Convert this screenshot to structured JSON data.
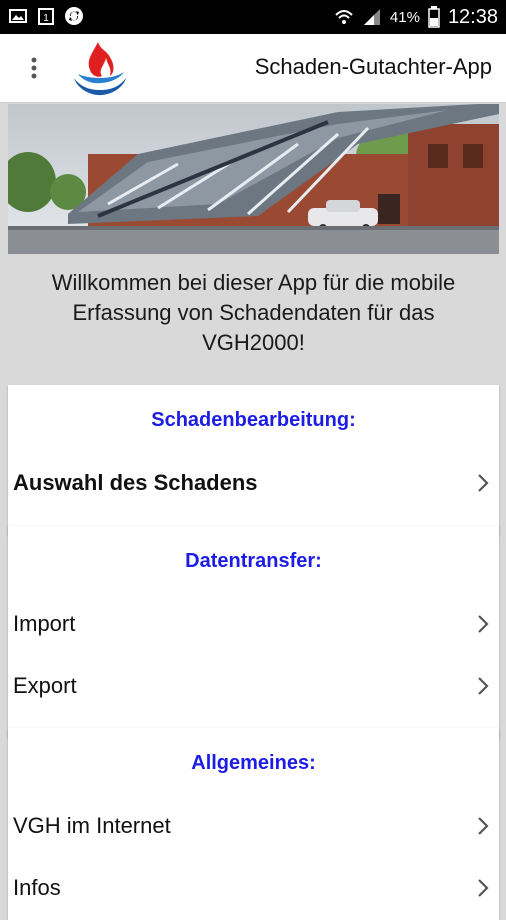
{
  "status_bar": {
    "battery_percent": "41%",
    "time": "12:38",
    "left_icons": [
      "photo-icon",
      "calendar-icon",
      "sync-icon"
    ],
    "right_icons": [
      "wifi-icon",
      "signal-icon",
      "battery-icon"
    ]
  },
  "app_bar": {
    "title": "Schaden-Gutachter-App",
    "menu_icon": "overflow-menu-icon",
    "logo_icon": "flame-logo-icon"
  },
  "welcome": {
    "line1": "Willkommen bei dieser App für die mobile",
    "line2": "Erfassung von Schadendaten für das",
    "line3": "VGH2000!"
  },
  "sections": [
    {
      "header": "Schadenbearbeitung:",
      "items": [
        {
          "label": "Auswahl des Schadens"
        }
      ]
    },
    {
      "header": "Datentransfer:",
      "items": [
        {
          "label": "Import"
        },
        {
          "label": "Export"
        }
      ]
    },
    {
      "header": "Allgemeines:",
      "items": [
        {
          "label": "VGH im Internet"
        },
        {
          "label": "Infos"
        }
      ]
    }
  ],
  "colors": {
    "section_header": "#1c1ce6",
    "background": "#d9d9d9",
    "status_bar": "#000000"
  }
}
